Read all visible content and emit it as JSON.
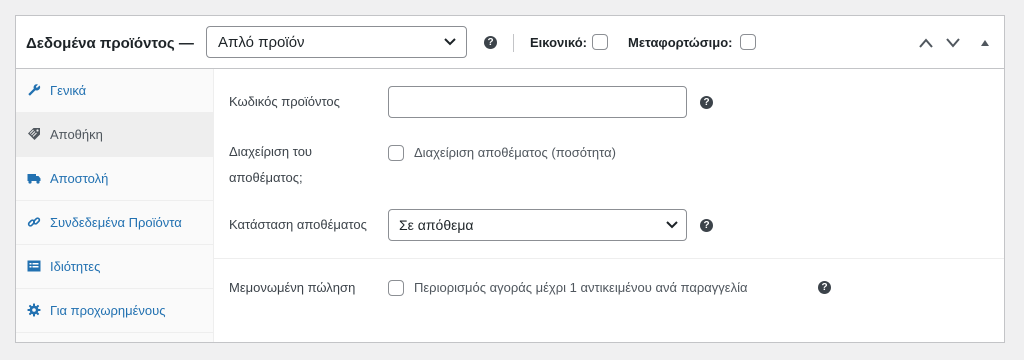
{
  "header": {
    "title": "Δεδομένα προϊόντος —",
    "product_type": {
      "selected": "Απλό προϊόν",
      "icon": "chevron-down-icon"
    },
    "help_icon": "question-circle-icon",
    "virtual_label": "Εικονικό:",
    "virtual_checked": false,
    "downloadable_label": "Μεταφορτώσιμο:",
    "downloadable_checked": false,
    "controls": [
      "chevron-up-icon",
      "chevron-down-icon",
      "triangle-up-icon"
    ]
  },
  "sidebar": {
    "items": [
      {
        "label": "Γενικά",
        "icon": "wrench-icon",
        "active": false
      },
      {
        "label": "Αποθήκη",
        "icon": "tag-icon",
        "active": true
      },
      {
        "label": "Αποστολή",
        "icon": "truck-icon",
        "active": false
      },
      {
        "label": "Συνδεδεμένα Προϊόντα",
        "icon": "link-icon",
        "active": false
      },
      {
        "label": "Ιδιότητες",
        "icon": "list-icon",
        "active": false
      },
      {
        "label": "Για προχωρημένους",
        "icon": "gear-icon",
        "active": false
      }
    ]
  },
  "inventory": {
    "sku_label": "Κωδικός προϊόντος",
    "sku_value": "",
    "manage_stock_label": "Διαχείριση του αποθέματος;",
    "manage_stock_option": "Διαχείριση αποθέματος (ποσότητα)",
    "manage_stock_checked": false,
    "stock_status_label": "Κατάσταση αποθέματος",
    "stock_status_value": "Σε απόθεμα",
    "sold_individually_label": "Μεμονωμένη πώληση",
    "sold_individually_option": "Περιορισμός αγοράς μέχρι 1 αντικειμένου ανά παραγγελία",
    "sold_individually_checked": false
  },
  "colors": {
    "link": "#2271b1",
    "text": "#1d2327",
    "border": "#c3c4c7",
    "tab_active_bg": "#eeeeee",
    "sidebar_bg": "#fafafa"
  }
}
